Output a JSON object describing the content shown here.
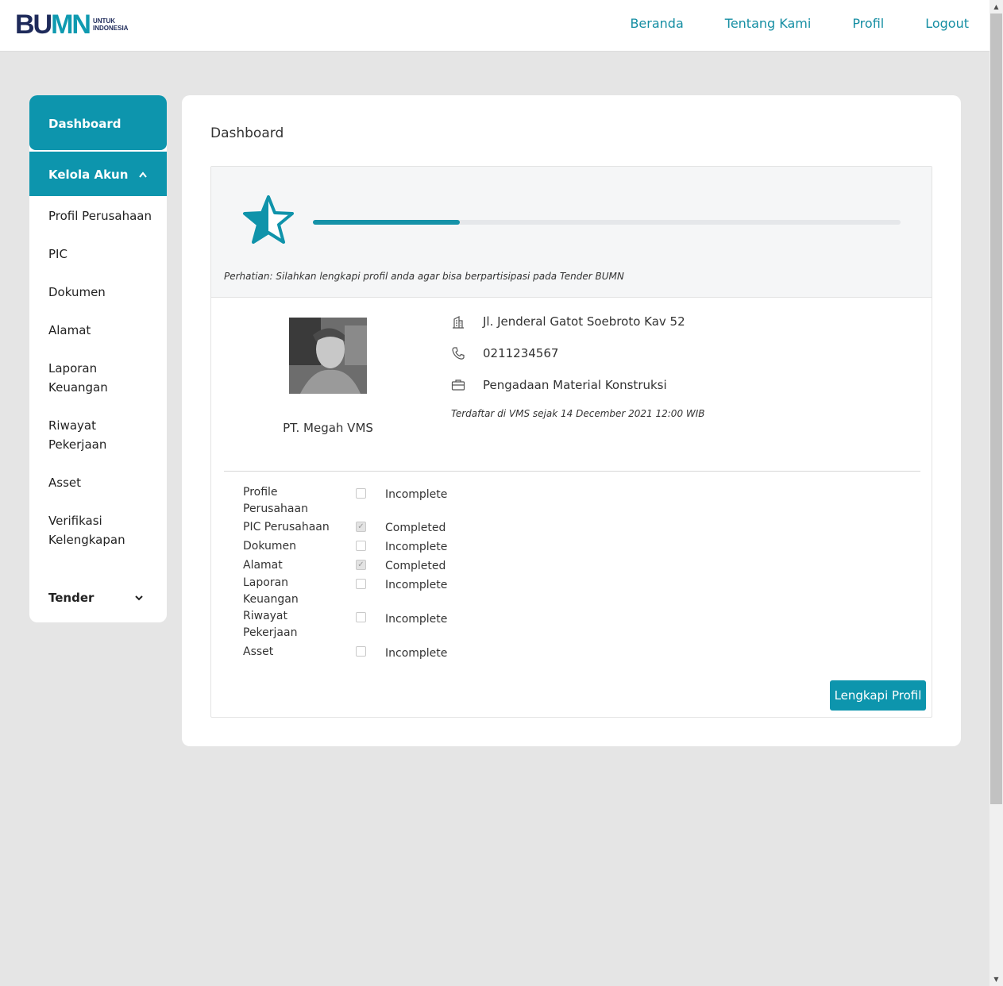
{
  "header": {
    "logo_main": "BUMN",
    "logo_sub_line1": "UNTUK",
    "logo_sub_line2": "INDONESIA",
    "nav": [
      "Beranda",
      "Tentang Kami",
      "Profil",
      "Logout"
    ]
  },
  "sidebar": {
    "dashboard": "Dashboard",
    "kelola_akun": "Kelola Akun",
    "items": [
      "Profil Perusahaan",
      "PIC",
      "Dokumen",
      "Alamat",
      "Laporan Keuangan",
      "Riwayat Pekerjaan",
      "Asset",
      "Verifikasi Kelengkapan"
    ],
    "tender": "Tender"
  },
  "main": {
    "title": "Dashboard",
    "progress": 0.25,
    "notice": "Perhatian: Silahkan lengkapi profil anda agar bisa berpartisipasi pada Tender BUMN",
    "company_name": "PT. Megah VMS",
    "address": "Jl. Jenderal Gatot Soebroto Kav 52",
    "phone": "0211234567",
    "business": "Pengadaan Material Konstruksi",
    "registered": "Terdaftar di VMS sejak 14 December 2021 12:00 WIB",
    "status": [
      {
        "label": "Profile Perusahaan",
        "checked": false,
        "value": "Incomplete"
      },
      {
        "label": "PIC Perusahaan",
        "checked": true,
        "value": "Completed"
      },
      {
        "label": "Dokumen",
        "checked": false,
        "value": "Incomplete"
      },
      {
        "label": "Alamat",
        "checked": true,
        "value": "Completed"
      },
      {
        "label": "Laporan Keuangan",
        "checked": false,
        "value": "Incomplete"
      },
      {
        "label": "Riwayat Pekerjaan",
        "checked": false,
        "value": "Incomplete"
      },
      {
        "label": "Asset",
        "checked": false,
        "value": "Incomplete"
      }
    ],
    "button": "Lengkapi Profil"
  },
  "colors": {
    "accent": "#0d95ad",
    "nav_link": "#158ea3",
    "logo_dark": "#1e2a5a"
  },
  "icons": [
    "star-icon",
    "building-icon",
    "phone-icon",
    "briefcase-icon",
    "chevron-up-icon",
    "chevron-down-icon"
  ]
}
